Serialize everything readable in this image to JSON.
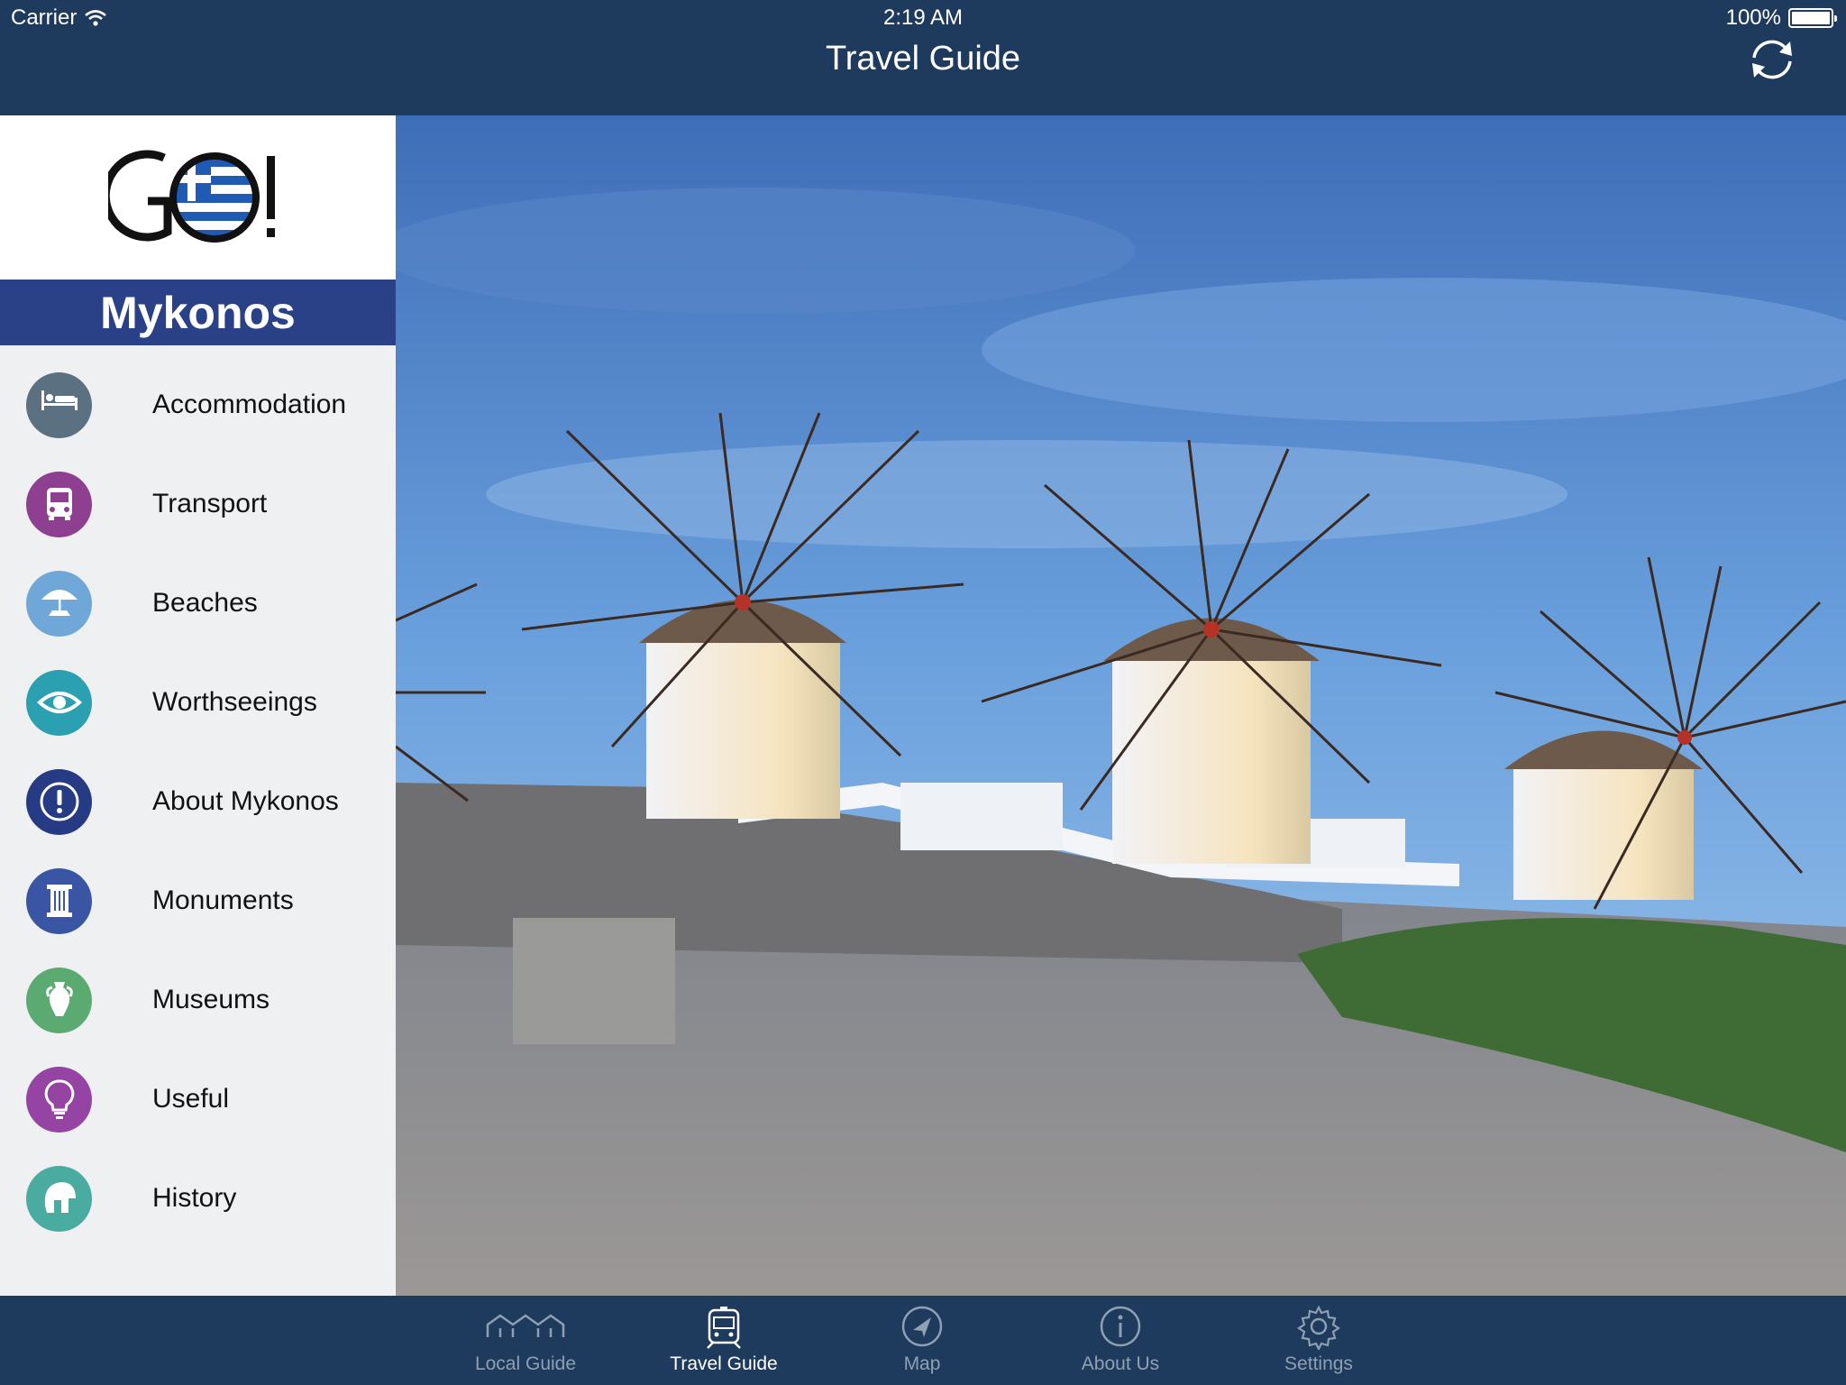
{
  "status_bar": {
    "carrier": "Carrier",
    "time": "2:19 AM",
    "battery": "100%"
  },
  "nav": {
    "title": "Travel Guide"
  },
  "sidebar": {
    "logo_text": "GO!",
    "city": "Mykonos",
    "items": [
      {
        "label": "Accommodation",
        "icon": "bed-icon",
        "color": "#5b7080"
      },
      {
        "label": "Transport",
        "icon": "bus-icon",
        "color": "#8e3f8f"
      },
      {
        "label": "Beaches",
        "icon": "beach-umbrella-icon",
        "color": "#6fa8d8"
      },
      {
        "label": "Worthseeings",
        "icon": "eye-icon",
        "color": "#2aa0b1"
      },
      {
        "label": "About Mykonos",
        "icon": "info-exclamation-icon",
        "color": "#273b84"
      },
      {
        "label": "Monuments",
        "icon": "column-icon",
        "color": "#3a55a3"
      },
      {
        "label": "Museums",
        "icon": "amphora-icon",
        "color": "#5aaa72"
      },
      {
        "label": "Useful",
        "icon": "lightbulb-icon",
        "color": "#9544a4"
      },
      {
        "label": "History",
        "icon": "helmet-icon",
        "color": "#4aaca0"
      }
    ]
  },
  "tabs": [
    {
      "label": "Local Guide",
      "icon": "houses-icon",
      "active": false
    },
    {
      "label": "Travel Guide",
      "icon": "tram-icon",
      "active": true
    },
    {
      "label": "Map",
      "icon": "navigation-arrow-icon",
      "active": false
    },
    {
      "label": "About Us",
      "icon": "info-icon",
      "active": false
    },
    {
      "label": "Settings",
      "icon": "gear-icon",
      "active": false
    }
  ],
  "colors": {
    "nav_background": "#1e3a5c",
    "city_banner": "#2a4188",
    "tab_active": "#ffffff",
    "tab_inactive": "#8fa0b3"
  }
}
